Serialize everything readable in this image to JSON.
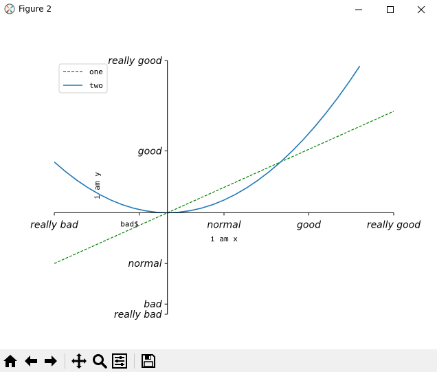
{
  "window": {
    "title": "Figure 2",
    "buttons": {
      "minimize": "minimize-icon",
      "maximize": "maximize-icon",
      "close": "close-icon"
    }
  },
  "toolbar": {
    "buttons": [
      "home-icon",
      "back-arrow-icon",
      "forward-arrow-icon",
      "pan-icon",
      "zoom-icon",
      "subplots-icon",
      "save-icon"
    ]
  },
  "chart_data": {
    "type": "line",
    "title": "",
    "xlabel": "i am x",
    "ylabel": "i am y",
    "xlim": [
      -1,
      2
    ],
    "ylim": [
      -2,
      3
    ],
    "xticks": [
      -1,
      -0.25,
      0.5,
      1.25,
      2
    ],
    "xtick_labels": [
      "really bad",
      "bad$",
      "normal",
      "good",
      "really good"
    ],
    "yticks": [
      -2,
      -1.8,
      -1,
      1.22,
      3
    ],
    "ytick_labels": [
      "really bad",
      "bad",
      "normal",
      "good",
      "really good"
    ],
    "grid": false,
    "legend": "upper-left",
    "spines": "centered at origin",
    "series": [
      {
        "name": "one",
        "style": "dashed",
        "color": "#008000",
        "x": [
          -1,
          2
        ],
        "y": [
          -1,
          2
        ]
      },
      {
        "name": "two",
        "style": "solid",
        "color": "#1f77b4",
        "x": [
          -1,
          -0.9,
          -0.8,
          -0.7,
          -0.6,
          -0.5,
          -0.4,
          -0.3,
          -0.2,
          -0.1,
          0,
          0.1,
          0.2,
          0.3,
          0.4,
          0.5,
          0.6,
          0.7,
          0.8,
          0.9,
          1.0,
          1.1,
          1.2,
          1.3,
          1.4,
          1.5,
          1.6,
          1.7
        ],
        "y": [
          1.0,
          0.81,
          0.64,
          0.49,
          0.36,
          0.25,
          0.16,
          0.09,
          0.04,
          0.01,
          0,
          0.01,
          0.04,
          0.09,
          0.16,
          0.25,
          0.36,
          0.49,
          0.64,
          0.81,
          1.0,
          1.21,
          1.44,
          1.69,
          1.96,
          2.25,
          2.56,
          2.89
        ]
      }
    ]
  }
}
